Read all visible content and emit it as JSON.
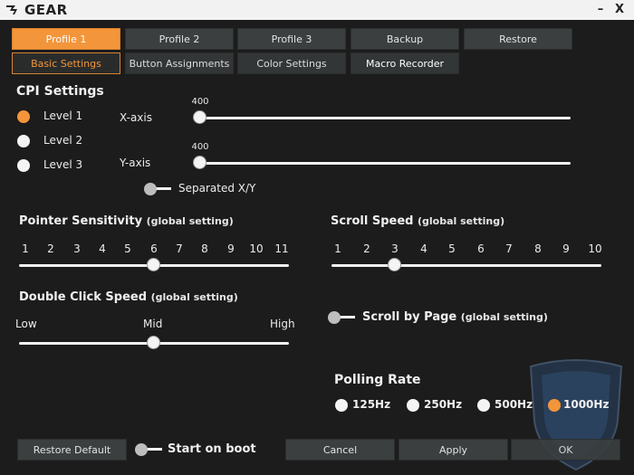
{
  "app": {
    "logo_text": "GEAR",
    "minimize": "–",
    "close": "X"
  },
  "profiles": [
    {
      "label": "Profile 1",
      "active": true
    },
    {
      "label": "Profile 2",
      "active": false
    },
    {
      "label": "Profile 3",
      "active": false
    },
    {
      "label": "Backup",
      "active": false
    },
    {
      "label": "Restore",
      "active": false
    }
  ],
  "subtabs": [
    {
      "label": "Basic Settings",
      "active": true
    },
    {
      "label": "Button Assignments",
      "active": false
    },
    {
      "label": "Color Settings",
      "active": false
    },
    {
      "label": "Macro Recorder",
      "active": false
    }
  ],
  "cpi": {
    "title": "CPI Settings",
    "levels": [
      {
        "label": "Level 1",
        "selected": true
      },
      {
        "label": "Level 2",
        "selected": false
      },
      {
        "label": "Level 3",
        "selected": false
      }
    ],
    "x_axis": {
      "label": "X-axis",
      "value": "400",
      "fraction": 0.0
    },
    "y_axis": {
      "label": "Y-axis",
      "value": "400",
      "fraction": 0.0
    },
    "separated_label": "Separated X/Y",
    "separated_on": false
  },
  "pointer": {
    "title": "Pointer Sensitivity",
    "note": "(global setting)",
    "ticks": [
      "1",
      "2",
      "3",
      "4",
      "5",
      "6",
      "7",
      "8",
      "9",
      "10",
      "11"
    ],
    "value": 6
  },
  "scroll_speed": {
    "title": "Scroll Speed",
    "note": "(global setting)",
    "ticks": [
      "1",
      "2",
      "3",
      "4",
      "5",
      "6",
      "7",
      "8",
      "9",
      "10"
    ],
    "value": 3
  },
  "double_click": {
    "title": "Double Click Speed",
    "note": "(global setting)",
    "low": "Low",
    "mid": "Mid",
    "high": "High",
    "fraction": 0.5
  },
  "scroll_by_page": {
    "label": "Scroll by Page",
    "note": "(global setting)",
    "on": false
  },
  "polling": {
    "title": "Polling Rate",
    "options": [
      {
        "label": "125Hz",
        "selected": false
      },
      {
        "label": "250Hz",
        "selected": false
      },
      {
        "label": "500Hz",
        "selected": false
      },
      {
        "label": "1000Hz",
        "selected": true
      }
    ]
  },
  "footer": {
    "restore_default": "Restore Default",
    "start_on_boot": "Start on boot",
    "cancel": "Cancel",
    "apply": "Apply",
    "ok": "OK"
  },
  "colors": {
    "accent": "#f3953a",
    "background": "#1c1c1c",
    "button": "#3b3f3f"
  }
}
